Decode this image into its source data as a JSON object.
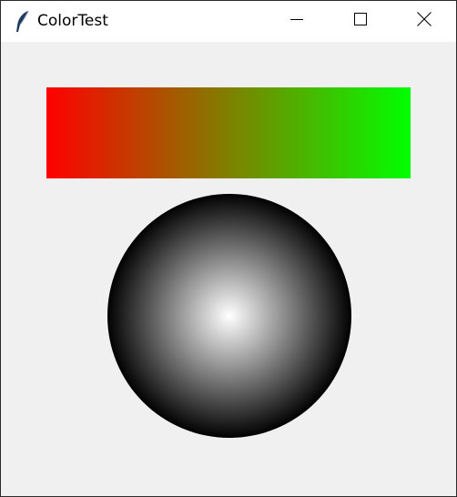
{
  "window": {
    "title": "ColorTest",
    "app_icon": "feather-icon",
    "controls": {
      "minimize_icon": "minimize-icon",
      "maximize_icon": "maximize-icon",
      "close_icon": "close-icon"
    }
  },
  "canvas": {
    "background_color": "#f0f0f0",
    "gradient_bar": {
      "start_color": "#ff0000",
      "end_color": "#00ff00"
    },
    "radial_circle": {
      "center_color": "#ffffff",
      "edge_color": "#000000"
    }
  }
}
